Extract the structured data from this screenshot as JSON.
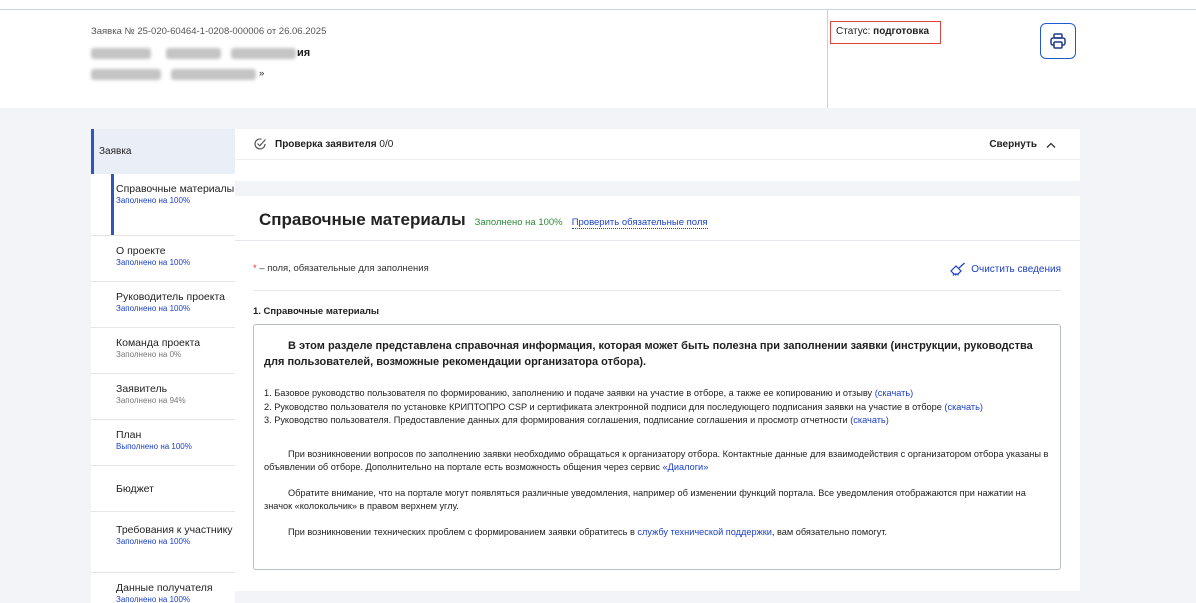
{
  "header": {
    "application_number": "Заявка № 25-020-60464-1-0208-000006 от 26.06.2025",
    "line2_tail": "ия",
    "line3_tail": "»",
    "status_label": "Статус:",
    "status_value": "подготовка",
    "print_icon": "printer-icon"
  },
  "sidebar": {
    "main_label": "Заявка",
    "items": [
      {
        "label": "Справочные материалы",
        "status": "Заполнено на 100%",
        "status_color": "blue",
        "active": true
      },
      {
        "label": "О проекте",
        "status": "Заполнено на 100%",
        "status_color": "blue"
      },
      {
        "label": "Руководитель проекта",
        "status": "Заполнено на 100%",
        "status_color": "blue"
      },
      {
        "label": "Команда проекта",
        "status": "Заполнено на 0%",
        "status_color": "gray"
      },
      {
        "label": "Заявитель",
        "status": "Заполнено на 94%",
        "status_color": "gray"
      },
      {
        "label": "План",
        "status": "Выполнено на 100%",
        "status_color": "blue"
      },
      {
        "label": "Бюджет",
        "status": ""
      },
      {
        "label": "Требования к участнику",
        "status": "Заполнено на 100%",
        "status_color": "blue"
      },
      {
        "label": "Данные получателя",
        "status": "Заполнено на 100%",
        "status_color": "blue"
      }
    ]
  },
  "check_card": {
    "title": "Проверка заявителя",
    "count": "0/0",
    "collapse_label": "Свернуть"
  },
  "main": {
    "title": "Справочные материалы",
    "filled": "Заполнено на 100%",
    "check_link": "Проверить обязательные поля",
    "required_star": "*",
    "required_note": "– поля, обязательные для заполнения",
    "clear_label": "Очистить сведения",
    "section_title": "1. Справочные материалы",
    "lead": "В этом разделе представлена справочная информация, которая может быть полезна при заполнении заявки (инструкции, руководства для пользователей, возможные рекомендации организатора отбора).",
    "list": [
      {
        "text": "1. Базовое руководство пользователя по формированию, заполнению и подаче заявки на участие в отборе, а также ее копированию и отзыву ",
        "link": "(скачать)"
      },
      {
        "text": "2. Руководство пользователя по установке КРИПТОПРО CSP и сертификата электронной подписи для последующего подписания заявки на участие в отборе ",
        "link": "(скачать)"
      },
      {
        "text": "3. Руководство пользователя. Предоставление данных для формирования соглашения, подписание соглашения и просмотр отчетности ",
        "link": "(скачать)"
      }
    ],
    "p1_text": "При возникновении вопросов по заполнению заявки необходимо обращаться к организатору отбора. Контактные данные для взаимодействия с организатором отбора указаны в объявлении об отборе. Дополнительно на портале есть возможность общения через сервис ",
    "p1_link": "«Диалоги»",
    "p2_text": "Обратите внимание, что на портале могут появляться различные уведомления, например об изменении функций портала. Все уведомления отображаются при нажатии на значок «колокольчик» в правом верхнем углу.",
    "p3_text": "При возникновении технических проблем с формированием заявки обратитесь в ",
    "p3_link": "службу технической поддержки",
    "p3_tail": ", вам обязательно помогут."
  },
  "colors": {
    "accent": "#1a3fc7",
    "status_border": "#e0453a",
    "filled_green": "#2c8a3a",
    "sidebar_active": "#2e58b8",
    "background": "#f2f4f7"
  }
}
